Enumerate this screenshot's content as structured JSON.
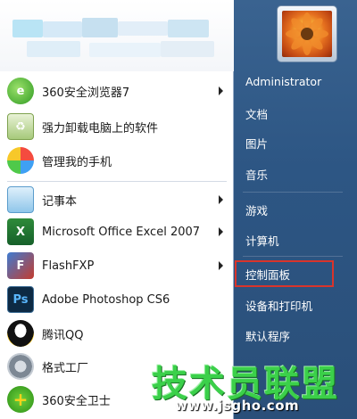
{
  "programs": [
    {
      "label": "360安全浏览器7",
      "icon": "browser-360-icon",
      "has_submenu": true
    },
    {
      "label": "强力卸载电脑上的软件",
      "icon": "uninstall-icon",
      "has_submenu": false
    },
    {
      "label": "管理我的手机",
      "icon": "phone-manager-icon",
      "has_submenu": false
    },
    {
      "label": "记事本",
      "icon": "notepad-icon",
      "has_submenu": true
    },
    {
      "label": "Microsoft Office Excel 2007",
      "icon": "excel-icon",
      "has_submenu": true
    },
    {
      "label": "FlashFXP",
      "icon": "flashfxp-icon",
      "has_submenu": true
    },
    {
      "label": "Adobe Photoshop CS6",
      "icon": "photoshop-icon",
      "has_submenu": false
    },
    {
      "label": "腾讯QQ",
      "icon": "qq-icon",
      "has_submenu": false
    },
    {
      "label": "格式工厂",
      "icon": "format-factory-icon",
      "has_submenu": false
    },
    {
      "label": "360安全卫士",
      "icon": "security-360-icon",
      "has_submenu": false
    }
  ],
  "icon_glyphs": {
    "excel": "X",
    "photoshop": "Ps",
    "flashfxp": "F",
    "security": "+"
  },
  "right_menu": {
    "user": "Administrator",
    "documents": "文档",
    "pictures": "图片",
    "music": "音乐",
    "games": "游戏",
    "computer": "计算机",
    "control_panel": "控制面板",
    "devices": "设备和打印机",
    "defaults": "默认程序"
  },
  "watermark": {
    "main": "技术员联盟",
    "url": "www.jsgho.com"
  },
  "colors": {
    "highlight_border": "#d9342b",
    "right_panel": "#2d5684",
    "watermark": "#3bd04a"
  }
}
